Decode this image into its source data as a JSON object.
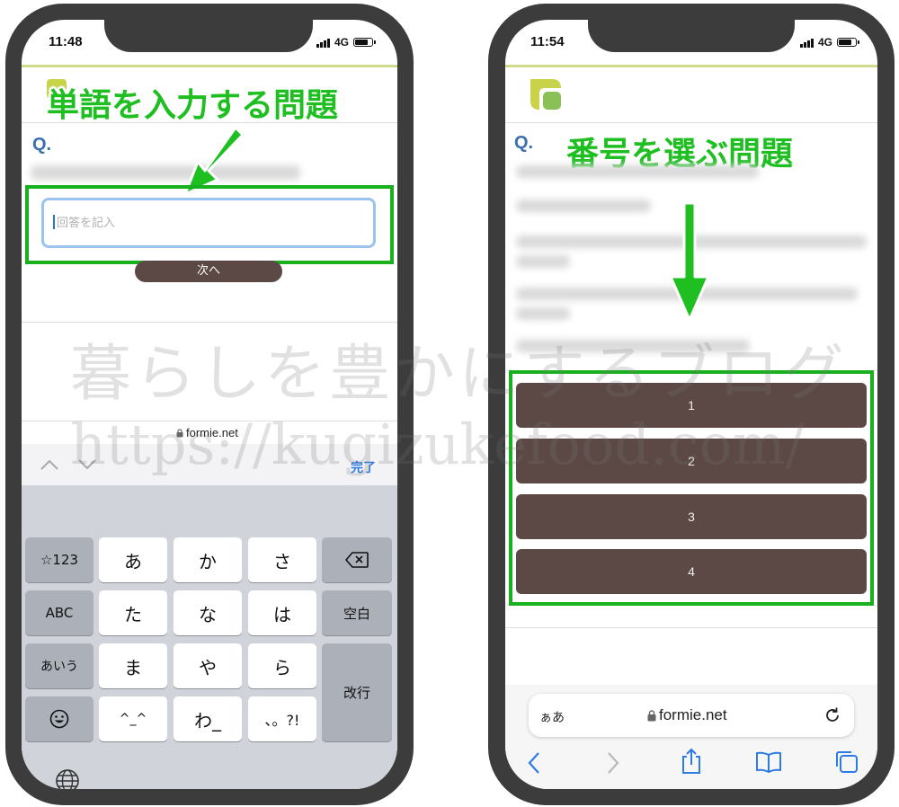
{
  "left_phone": {
    "time": "11:48",
    "network": "4G",
    "headline": "単語を入力する問題",
    "question_label": "Q.",
    "answer_placeholder": "回答を記入",
    "next_button": "次へ",
    "url": "formie.net",
    "keyboard_done": "完了",
    "keys": {
      "numbers": "☆123",
      "abc": "ABC",
      "aiu": "あいう",
      "a": "あ",
      "ka": "か",
      "sa": "さ",
      "ta": "た",
      "na": "な",
      "ha": "は",
      "ma": "ま",
      "ya": "や",
      "ra": "ら",
      "dakuten": "^_^",
      "wa": "わ_",
      "punct": "、。?!",
      "space": "空白",
      "enter": "改行"
    }
  },
  "right_phone": {
    "time": "11:54",
    "network": "4G",
    "headline": "番号を選ぶ問題",
    "question_label": "Q.",
    "choices": [
      "1",
      "2",
      "3",
      "4"
    ],
    "url_text_size": "ぁあ",
    "url": "formie.net"
  },
  "watermark": {
    "line1": "暮らしを豊かにするブログ",
    "line2": "https://kugizukefood.com/"
  },
  "colors": {
    "highlight_green": "#19b01f",
    "button_brown": "#5c4945",
    "phone_frame": "#3c3c3c",
    "link_blue": "#2d7be5"
  }
}
